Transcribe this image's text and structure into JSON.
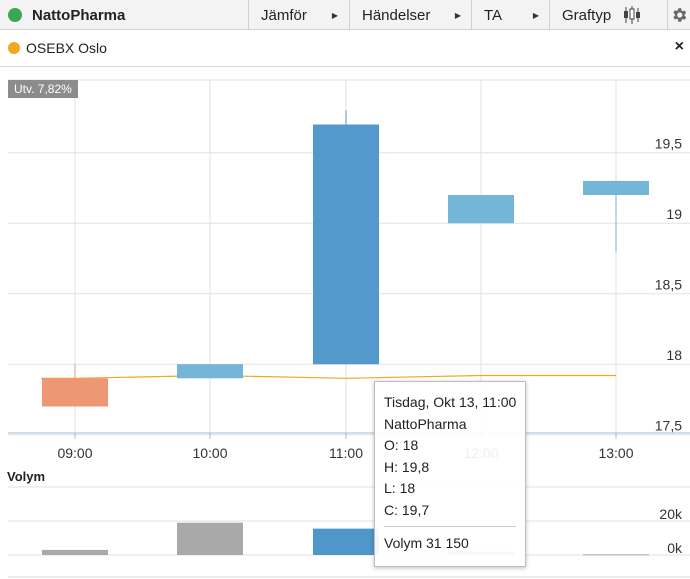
{
  "toolbar": {
    "title": "NattoPharma",
    "title_dot_color": "#3aa757",
    "items": [
      {
        "label": "Jämför"
      },
      {
        "label": "Händelser"
      },
      {
        "label": "TA"
      },
      {
        "label": "Graftyp"
      }
    ],
    "icons": [
      "candlestick-icon",
      "gear-icon"
    ]
  },
  "legend": {
    "label": "OSEBX Oslo",
    "dot_color": "#f5a623",
    "close": "×"
  },
  "badge": "Utv. 7,82%",
  "volume_label": "Volym",
  "tooltip": {
    "date": "Tisdag, Okt 13, 11:00",
    "name": "NattoPharma",
    "open": "O: 18",
    "high": "H: 19,8",
    "low": "L: 18",
    "close": "C: 19,7",
    "volume": "Volym 31 150"
  },
  "chart_data": [
    {
      "type": "candlestick",
      "title": "NattoPharma",
      "x": [
        "09:00",
        "10:00",
        "11:00",
        "12:00",
        "13:00"
      ],
      "candles": [
        {
          "x": "09:00",
          "open": 17.9,
          "high": 18.0,
          "low": 17.7,
          "close": 17.7
        },
        {
          "x": "10:00",
          "open": 17.9,
          "high": 18.0,
          "low": 17.9,
          "close": 18.0
        },
        {
          "x": "11:00",
          "open": 18.0,
          "high": 19.8,
          "low": 18.0,
          "close": 19.7
        },
        {
          "x": "12:00",
          "open": 19.0,
          "high": 19.2,
          "low": 19.0,
          "close": 19.2
        },
        {
          "x": "13:00",
          "open": 19.2,
          "high": 19.3,
          "low": 18.8,
          "close": 19.3
        }
      ],
      "comparison_series": {
        "name": "OSEBX Oslo",
        "color": "#f5a623",
        "values": [
          17.9,
          17.92,
          17.9,
          17.92,
          17.92
        ]
      },
      "y_ticks": [
        "17,5",
        "18",
        "18,5",
        "19",
        "19,5"
      ],
      "y_tick_values": [
        17.5,
        18,
        18.5,
        19,
        19.5
      ],
      "ylim": [
        17.45,
        19.95
      ],
      "up_color": "#74b6d8",
      "up_strong_color": "#5399cc",
      "down_color": "#ee9775",
      "grid": true
    },
    {
      "type": "bar",
      "title": "Volym",
      "categories": [
        "09:00",
        "10:00",
        "11:00",
        "12:00",
        "13:00"
      ],
      "values": [
        3000,
        19000,
        15500,
        2000,
        400
      ],
      "y_ticks": [
        "0k",
        "20k"
      ],
      "y_tick_values": [
        0,
        20000
      ],
      "ylim": [
        0,
        40000
      ],
      "bar_color": "#a9a9a9",
      "highlight_color": "#4e97c8"
    }
  ]
}
